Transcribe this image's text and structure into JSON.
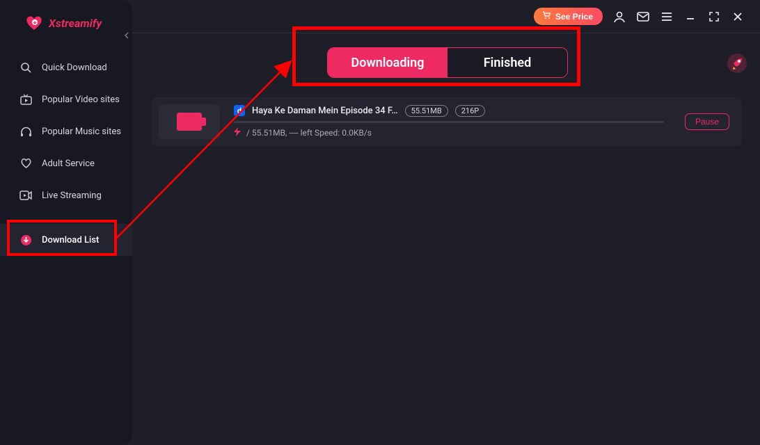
{
  "brand": {
    "name": "Xstreamify"
  },
  "sidebar": {
    "items": [
      {
        "label": "Quick Download"
      },
      {
        "label": "Popular Video sites"
      },
      {
        "label": "Popular Music sites"
      },
      {
        "label": "Adult Service"
      },
      {
        "label": "Live Streaming"
      },
      {
        "label": "Download List"
      }
    ]
  },
  "topbar": {
    "see_price_label": "See Price"
  },
  "tabs": {
    "downloading": "Downloading",
    "finished": "Finished"
  },
  "download": {
    "source_badge": "d",
    "title": "Haya Ke Daman Mein Episode 34 F…",
    "size": "55.51MB",
    "quality": "216P",
    "status_line": "/ 55.51MB, ---- left Speed: 0.0KB/s",
    "pause_label": "Pause"
  }
}
